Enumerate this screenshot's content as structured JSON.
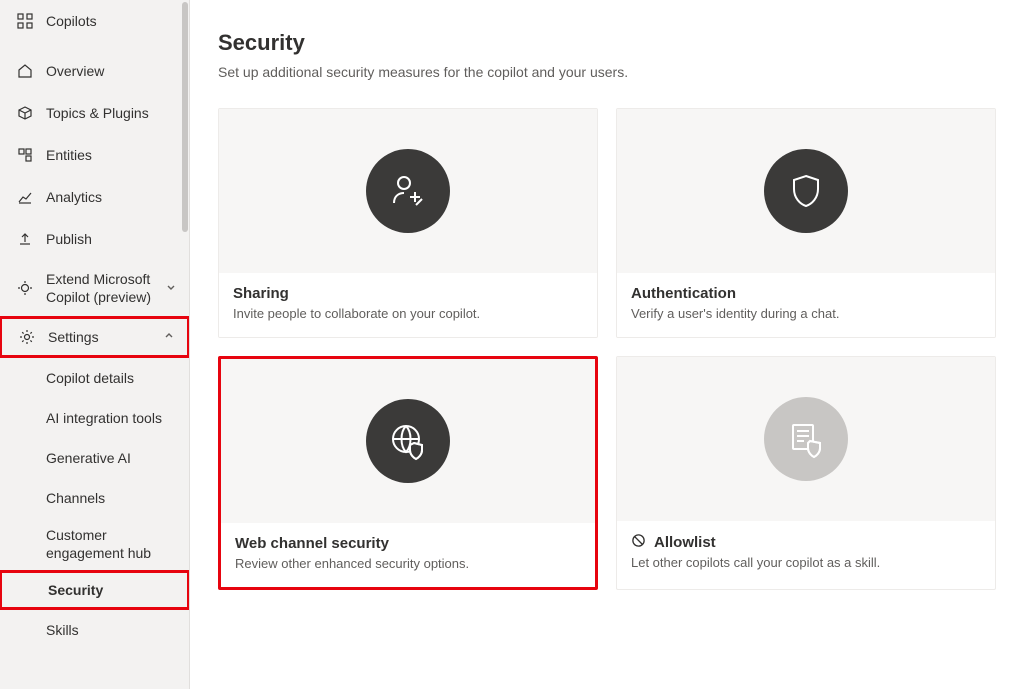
{
  "sidebar": {
    "copilots": "Copilots",
    "overview": "Overview",
    "topics": "Topics & Plugins",
    "entities": "Entities",
    "analytics": "Analytics",
    "publish": "Publish",
    "extend": "Extend Microsoft Copilot (preview)",
    "settings": "Settings",
    "copilot_details": "Copilot details",
    "ai_integration": "AI integration tools",
    "gen_ai": "Generative AI",
    "channels": "Channels",
    "ce_hub": "Customer engagement hub",
    "security": "Security",
    "skills": "Skills"
  },
  "page": {
    "title": "Security",
    "subtitle": "Set up additional security measures for the copilot and your users."
  },
  "cards": {
    "sharing": {
      "title": "Sharing",
      "desc": "Invite people to collaborate on your copilot."
    },
    "auth": {
      "title": "Authentication",
      "desc": "Verify a user's identity during a chat."
    },
    "web": {
      "title": "Web channel security",
      "desc": "Review other enhanced security options."
    },
    "allow": {
      "title": "Allowlist",
      "desc": "Let other copilots call your copilot as a skill."
    }
  }
}
